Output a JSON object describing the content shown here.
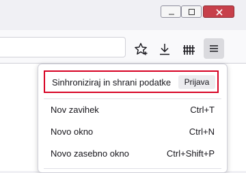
{
  "window_controls": {
    "icons": [
      "minimize-icon",
      "maximize-icon",
      "close-icon"
    ],
    "close_color": "#c7404a"
  },
  "toolbar": {
    "icons": [
      "bookmark-star-icon",
      "download-icon",
      "library-icon",
      "hamburger-menu-icon"
    ]
  },
  "app_menu": {
    "sync": {
      "label": "Sinhroniziraj in shrani podatke",
      "signin_label": "Prijava",
      "highlight_color": "#d70022"
    },
    "items": [
      {
        "label": "Nov zavihek",
        "shortcut": "Ctrl+T"
      },
      {
        "label": "Novo okno",
        "shortcut": "Ctrl+N"
      },
      {
        "label": "Novo zasebno okno",
        "shortcut": "Ctrl+Shift+P"
      }
    ]
  }
}
